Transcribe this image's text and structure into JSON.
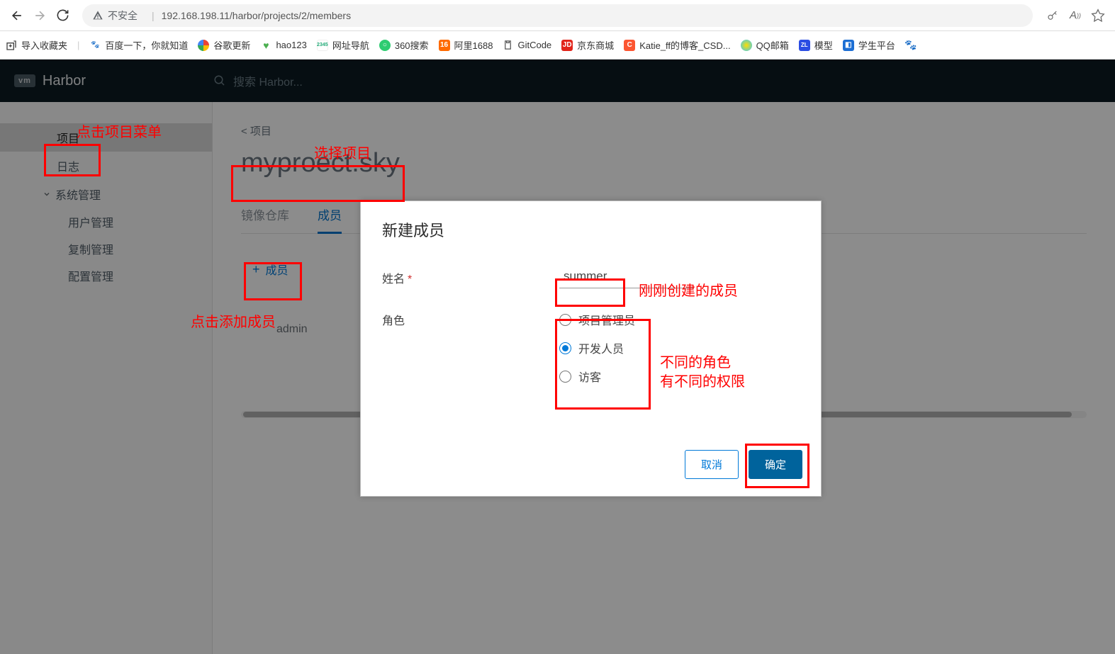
{
  "browser": {
    "insecure_label": "不安全",
    "url": "192.168.198.11/harbor/projects/2/members"
  },
  "bookmarks": {
    "import": "导入收藏夹",
    "items": [
      {
        "label": "百度一下，你就知道"
      },
      {
        "label": "谷歌更新"
      },
      {
        "label": "hao123"
      },
      {
        "label": "网址导航"
      },
      {
        "label": "360搜索"
      },
      {
        "label": "阿里1688"
      },
      {
        "label": "GitCode"
      },
      {
        "label": "京东商城"
      },
      {
        "label": "Katie_ff的博客_CSD..."
      },
      {
        "label": "QQ邮箱"
      },
      {
        "label": "模型"
      },
      {
        "label": "学生平台"
      }
    ]
  },
  "brand": {
    "logo": "vm",
    "name": "Harbor"
  },
  "app_search_placeholder": "搜索 Harbor...",
  "sidebar": {
    "projects": "项目",
    "logs": "日志",
    "admin": "系统管理",
    "sub": [
      "用户管理",
      "复制管理",
      "配置管理"
    ]
  },
  "main": {
    "breadcrumb": "< 项目",
    "project_name": "myproect.sky",
    "tabs": {
      "repos": "镜像仓库",
      "members": "成员"
    },
    "add_member_label": "成员",
    "table_user": "admin"
  },
  "modal": {
    "title": "新建成员",
    "name_label": "姓名",
    "name_value": "summer",
    "role_label": "角色",
    "roles": [
      "项目管理员",
      "开发人员",
      "访客"
    ],
    "cancel": "取消",
    "ok": "确定"
  },
  "annotations": {
    "click_proj_menu": "点击项目菜单",
    "select_proj": "选择项目",
    "click_add_member": "点击添加成员",
    "created_member": "刚刚创建的成员",
    "roles_note1": "不同的角色",
    "roles_note2": "有不同的权限"
  }
}
